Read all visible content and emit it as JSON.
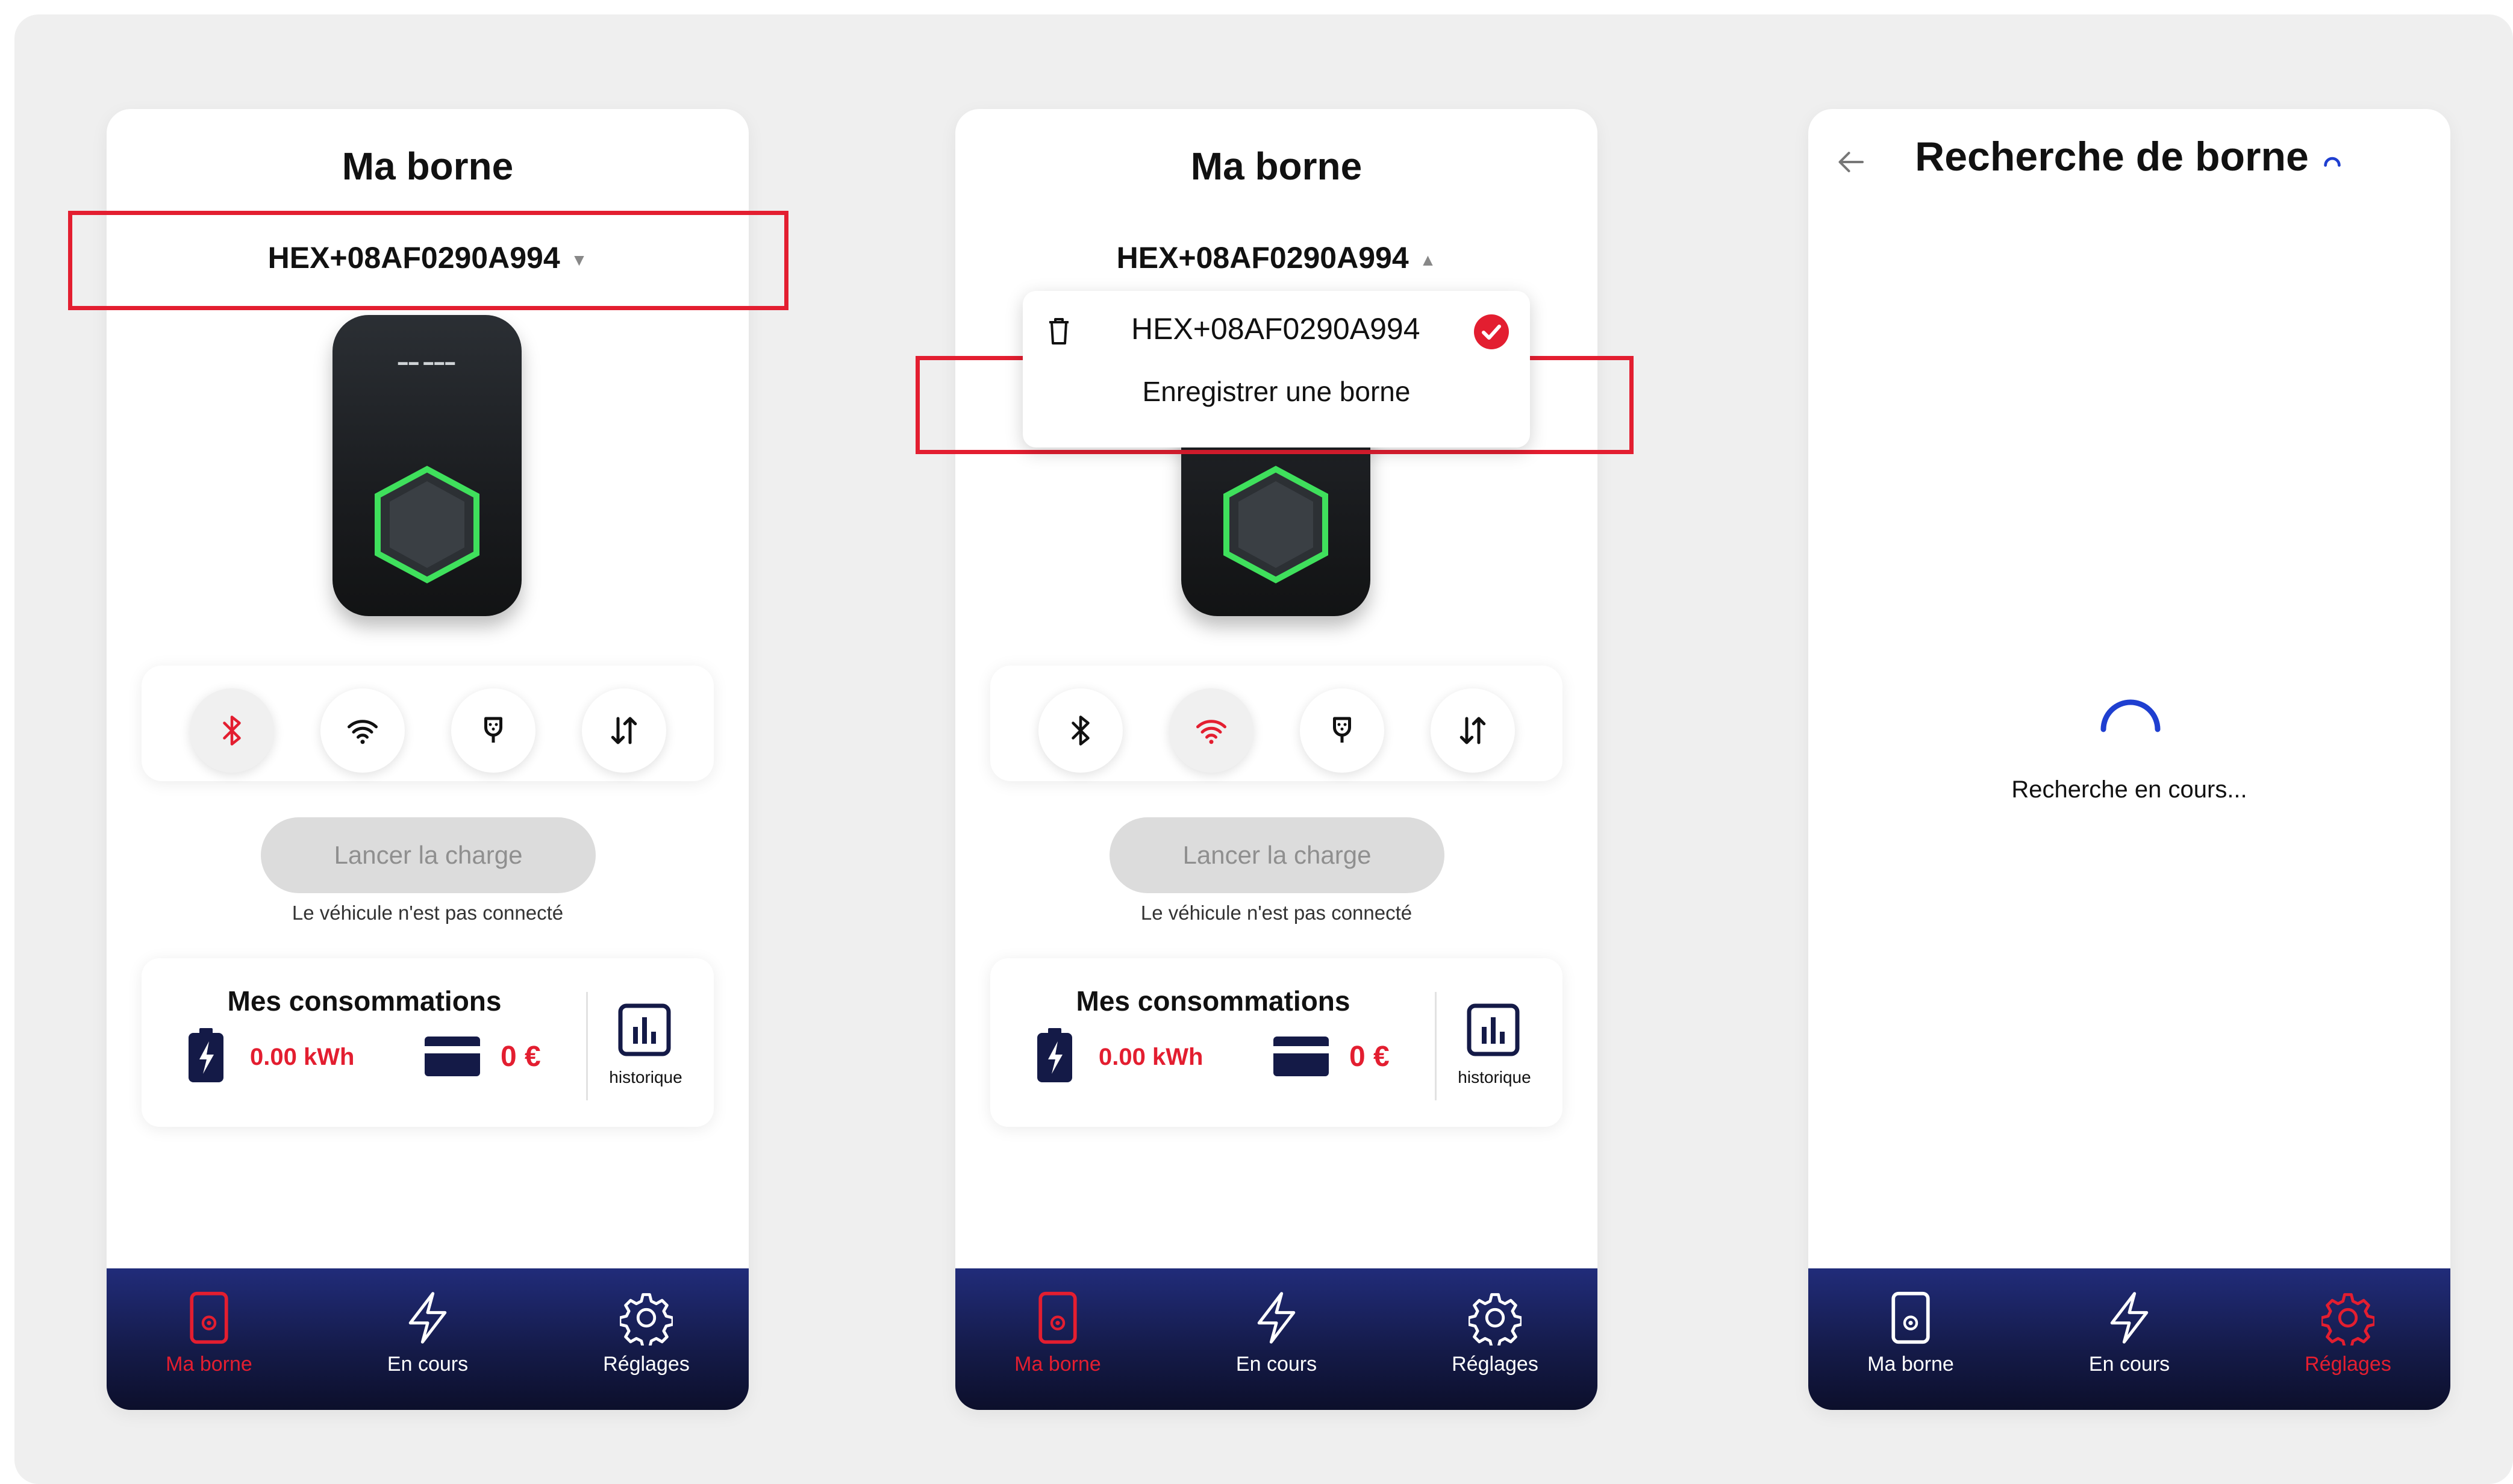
{
  "accent_red": "#e31e30",
  "navy": "#171e55",
  "screen1": {
    "title": "Ma borne",
    "device": "HEX+08AF0290A994",
    "launch_label": "Lancer la charge",
    "note": "Le véhicule n'est pas connecté",
    "conso_title": "Mes consommations",
    "energy": "0.00 kWh",
    "cost": "0 €",
    "history": "historique",
    "active_action": "bluetooth",
    "tabs": [
      "Ma borne",
      "En cours",
      "Réglages"
    ],
    "active_tab": "Ma borne"
  },
  "screen2": {
    "title": "Ma borne",
    "device": "HEX+08AF0290A994",
    "dropdown_items": [
      "HEX+08AF0290A994",
      "Enregistrer une borne"
    ],
    "launch_label": "Lancer la charge",
    "note": "Le véhicule n'est pas connecté",
    "conso_title": "Mes consommations",
    "energy": "0.00 kWh",
    "cost": "0 €",
    "history": "historique",
    "active_action": "wifi",
    "tabs": [
      "Ma borne",
      "En cours",
      "Réglages"
    ],
    "active_tab": "Ma borne"
  },
  "screen3": {
    "title": "Recherche de borne",
    "status": "Recherche en cours...",
    "tabs": [
      "Ma borne",
      "En cours",
      "Réglages"
    ],
    "active_tab": "Réglages"
  },
  "icons": [
    "bluetooth-icon",
    "wifi-icon",
    "plug-icon",
    "transfer-icon",
    "battery-icon",
    "card-icon",
    "chart-icon",
    "charger-icon",
    "bolt-icon",
    "gear-icon",
    "trash-icon",
    "check-icon",
    "back-arrow-icon",
    "spinner-icon"
  ]
}
